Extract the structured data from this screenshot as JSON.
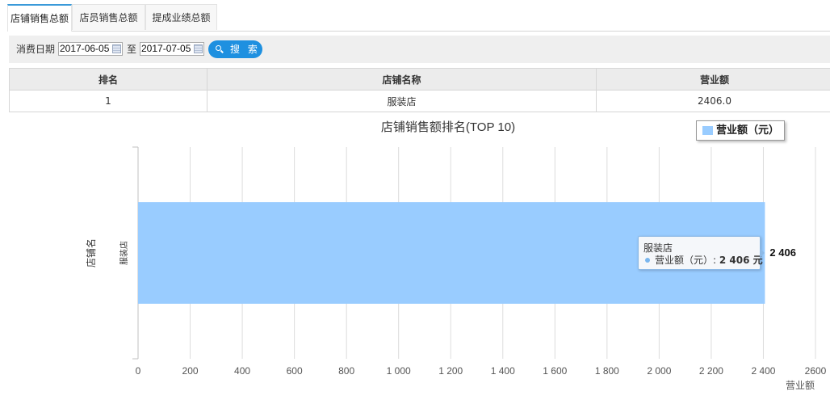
{
  "tabs": [
    {
      "label": "店铺销售总额",
      "active": true
    },
    {
      "label": "店员销售总额",
      "active": false
    },
    {
      "label": "提成业绩总额",
      "active": false
    }
  ],
  "filter": {
    "date_label": "消费日期",
    "start_date": "2017-06-05",
    "to_label": "至",
    "end_date": "2017-07-05",
    "search_label": "搜 索"
  },
  "table": {
    "headers": [
      "排名",
      "店铺名称",
      "营业额"
    ],
    "rows": [
      [
        "1",
        "服装店",
        "2406.0"
      ]
    ]
  },
  "legend": {
    "label": "营业额（元）",
    "color": "#99ccff"
  },
  "tooltip": {
    "title": "服装店",
    "series_label": "营业额（元）: ",
    "value_text": "2 406 元"
  },
  "chart_data": {
    "type": "bar",
    "orientation": "horizontal",
    "title": "店铺销售额排名(TOP 10)",
    "categories": [
      "服装店"
    ],
    "series": [
      {
        "name": "营业额（元）",
        "values": [
          2406
        ]
      }
    ],
    "data_labels": [
      "2 406"
    ],
    "xlabel": "营业额",
    "ylabel": "店铺名",
    "xlim": [
      0,
      2600
    ],
    "xticks": [
      "0",
      "200",
      "400",
      "600",
      "800",
      "1 000",
      "1 200",
      "1 400",
      "1 600",
      "1 800",
      "2 000",
      "2 200",
      "2 400",
      "2600"
    ],
    "grid": true,
    "legend_position": "top-right",
    "bar_color": "#99ccff"
  }
}
